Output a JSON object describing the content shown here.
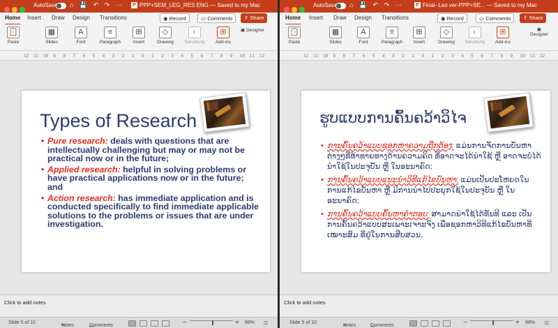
{
  "left": {
    "autosave_label": "AutoSave",
    "doc_title": "PPP+SEM_LEG_RES ENG — Saved to my Mac",
    "tabs": [
      "Home",
      "Insert",
      "Draw",
      "Design",
      "Transitions"
    ],
    "record_label": "Record",
    "comments_label": "Comments",
    "share_label": "Share",
    "ribbon": {
      "paste": "Paste",
      "slides": "Slides",
      "font": "Font",
      "paragraph": "Paragraph",
      "insert": "Insert",
      "drawing": "Drawing",
      "sensitivity": "Sensitivity",
      "addins": "Add-ins",
      "designer": "Designer"
    },
    "slide": {
      "title": "Types of Research",
      "bullets": [
        {
          "term": "Pure research:",
          "text": " deals with questions that are intellectually challenging but may or may not be practical now or in the future;"
        },
        {
          "term": "Applied research:",
          "text": " helpful in solving problems or have practical applications now or in the future; and"
        },
        {
          "term": "Action research:",
          "text": " has immediate application and is conducted specifically to find immediate applicable solutions to the problems or issues that are under investigation."
        }
      ]
    },
    "notes_placeholder": "Click to add notes",
    "status": {
      "slide_info": "Slide 5 of 10",
      "notes": "Notes",
      "comments": "Comments",
      "zoom": "88%"
    }
  },
  "right": {
    "autosave_label": "AutoSave",
    "doc_title": "Final- Lao ver-PPP+SE... — Saved to my Mac",
    "tabs": [
      "Home",
      "Insert",
      "Draw",
      "Design",
      "Transitions"
    ],
    "record_label": "Record",
    "comments_label": "Comments",
    "share_label": "Share",
    "ribbon": {
      "paste": "Paste",
      "slides": "Slides",
      "font": "Font",
      "paragraph": "Paragraph",
      "insert": "Insert",
      "drawing": "Drawing",
      "sensitivity": "Sensitivity",
      "addins": "Add-ins",
      "designer": "Designer"
    },
    "slide": {
      "title": "ຮູບແບບການຄົ້ນຄວ້າວິໄຈ",
      "bullets": [
        {
          "term": "ການຄົ້ນຄວ້າແບບຊອກຫາຄວາມຖືກຕ້ອງ:",
          "text": " ແມ່ນການຈັດການບັນຫາຕ່າງໆທີ່ທ້າທາຍທາງດ້ານຄວາມຄິດ ທີ່ອາດຈະໄດ້ນໍາໃຊ້ ຫຼື ອາດຈະບໍ່ໄດ້ນໍາໃຊ້ໃນປະຈຸບັນ ຫຼື ໃນອະນາຄົດ;"
        },
        {
          "term": "ການຄົ້ນຄວ້າແບບແນະນໍາວິທີແກ້ໄຂບັນຫາ:",
          "text": " ແມ່ນເປັນປະໂຫຍດໃນການແກ້ໄຂບັນຫາ ຫຼື ມີການນໍາໄປປະຍຸກໃຊ້ໃນປະຈຸບັນ ຫຼື ໃນອະນາຄົດ;"
        },
        {
          "term": "ການຄົ້ນຄວ້າແບບຄົ້ນຫາຄໍາຕອບ:",
          "text": " ສາມາດນໍາໃຊ້ໄດ້ທັນທີ ແລະ ເປັນການຄົ້ນຄວ້າແບບສະເພາະເຈາະຈົງ ເພື່ອຊອກຫາວິທີແກ້ໄຂບັນຫາທີ່ເໝາະສົມ ທີ່ຢູ່ໃນການສືບສວນ."
        }
      ]
    },
    "notes_placeholder": "Click to add notes",
    "status": {
      "slide_info": "Slide 5 of 10",
      "notes": "Notes",
      "comments": "Comments",
      "zoom": "88%"
    }
  },
  "colors": {
    "accent": "#c43e1c",
    "title_blue": "#2b3a6e",
    "term_red": "#e02a1e"
  },
  "ruler_numbers": [
    "12",
    "11",
    "10",
    "9",
    "8",
    "7",
    "6",
    "5",
    "4",
    "3",
    "2",
    "1",
    "0",
    "1",
    "2",
    "3",
    "4",
    "5",
    "6",
    "7",
    "8",
    "9",
    "10",
    "11",
    "12"
  ]
}
